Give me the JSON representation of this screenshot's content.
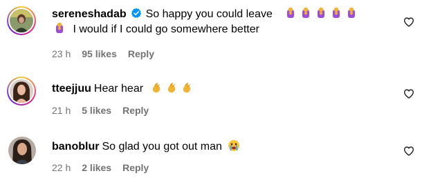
{
  "comments": [
    {
      "username": "sereneshadab",
      "verified": true,
      "text_line1": "So happy you could leave",
      "text_line2": "I would if I could go somewhere better",
      "emoji_name": "person-bowing-emoji",
      "time": "23 h",
      "likes": "95 likes",
      "reply": "Reply"
    },
    {
      "username": "tteejjuu",
      "verified": false,
      "text": "Hear hear",
      "emoji_name": "clapping-hands-emoji",
      "time": "21 h",
      "likes": "5 likes",
      "reply": "Reply"
    },
    {
      "username": "banoblur",
      "verified": false,
      "text": "So glad you got out man",
      "emoji_name": "crying-face-emoji",
      "time": "22 h",
      "likes": "2 likes",
      "reply": "Reply"
    }
  ],
  "icons": {
    "like": "heart-outline-icon",
    "verified": "verified-badge-icon"
  },
  "colors": {
    "meta_text": "#737373",
    "verified_blue": "#0095f6"
  }
}
